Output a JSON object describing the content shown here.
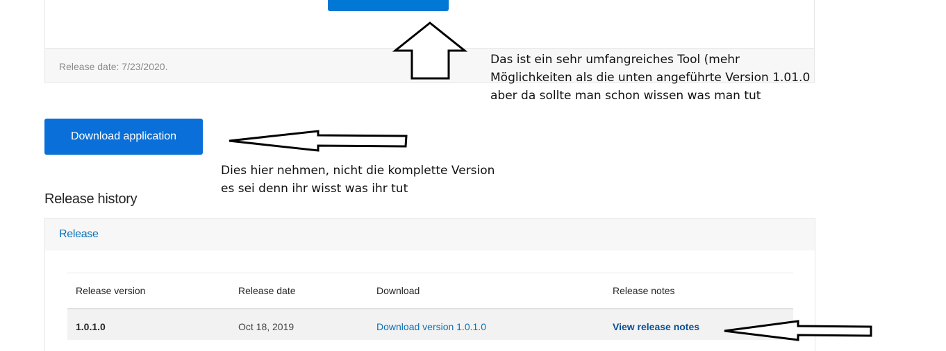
{
  "top_card": {
    "release_date": "Release date: 7/23/2020."
  },
  "download_app_button": "Download application",
  "release_history": {
    "title": "Release history",
    "tab_label": "Release",
    "columns": [
      "Release version",
      "Release date",
      "Download",
      "Release notes"
    ],
    "rows": [
      {
        "version": "1.0.1.0",
        "date": "Oct 18, 2019",
        "download": "Download version 1.0.1.0",
        "notes": "View release notes"
      }
    ]
  },
  "annotations": {
    "top_note_line1": "Das ist ein sehr umfangreiches Tool (mehr",
    "top_note_line2": "Möglichkeiten als die unten angeführte Version 1.01.0",
    "top_note_line3": "aber da sollte man schon wissen was man tut",
    "mid_note_line1": "Dies hier nehmen, nicht die komplette Version",
    "mid_note_line2": "es sei denn ihr wisst was ihr tut"
  },
  "colors": {
    "primary_button": "#0a6fd8",
    "link": "#0a71b8",
    "annotation": "#000000"
  }
}
